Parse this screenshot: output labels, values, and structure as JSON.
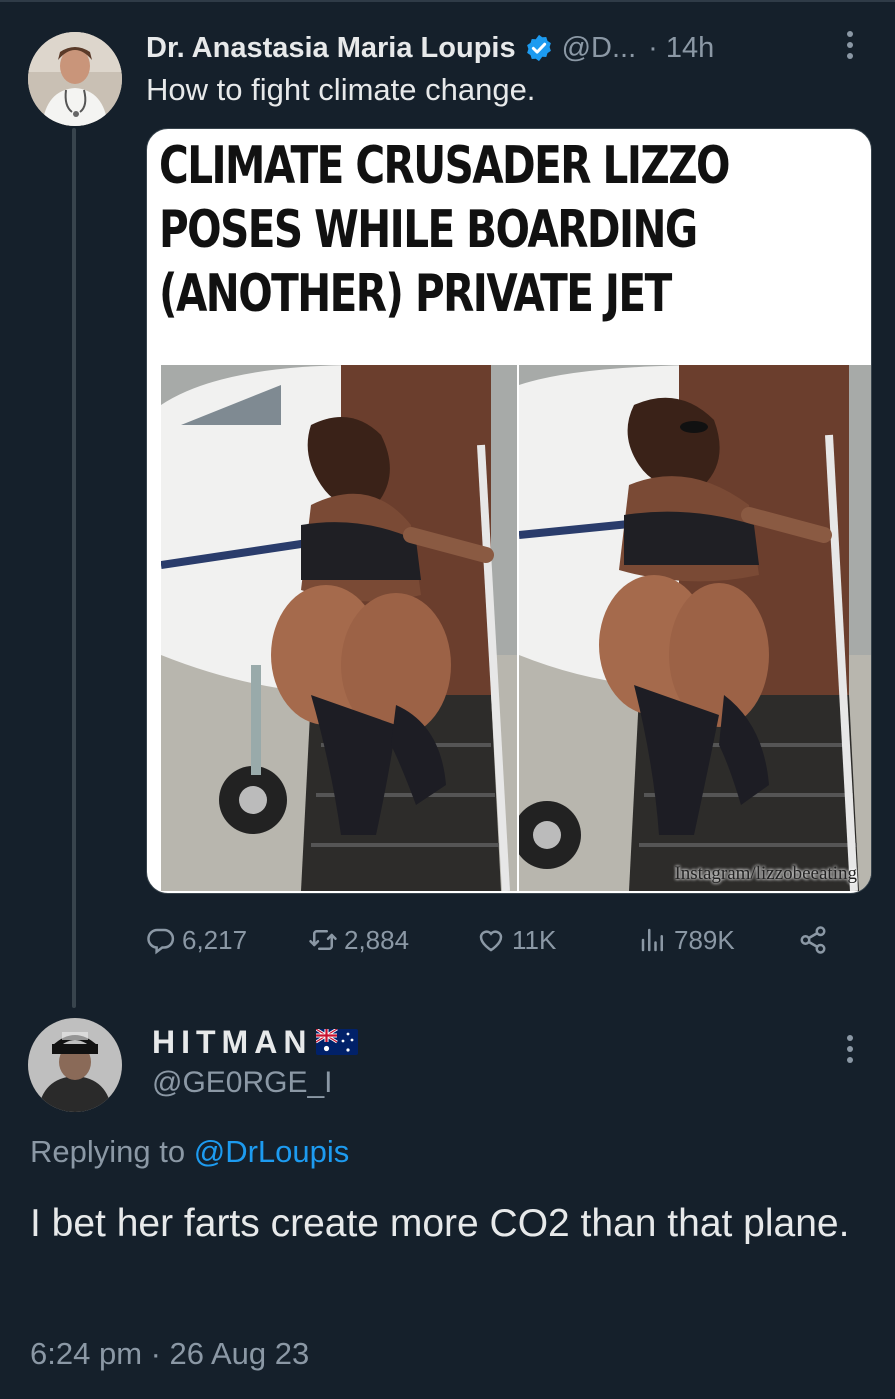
{
  "tweet": {
    "author_name": "Dr. Anastasia Maria Loupis",
    "verified_icon": "verified-badge-icon",
    "handle": "@D...",
    "separator": "·",
    "time": "14h",
    "text": "How to fight climate change.",
    "media": {
      "headline_lines": [
        "CLIMATE CRUSADER LIZZO",
        "POSES WHILE BOARDING",
        "(ANOTHER) PRIVATE JET"
      ],
      "credit": "Instagram/lizzobeeating"
    },
    "actions": {
      "replies": "6,217",
      "retweets": "2,884",
      "likes": "11K",
      "views": "789K"
    }
  },
  "reply": {
    "author_name": "HITMAN",
    "flag_icon": "australia-flag-icon",
    "handle": "@GE0RGE_I",
    "replying_prefix": "Replying to",
    "replying_to": "@DrLoupis",
    "text": "I bet her farts create more CO2 than that plane.",
    "timestamp": "6:24 pm · 26 Aug 23"
  },
  "colors": {
    "background": "#15202b",
    "primary_text": "#e7e9ea",
    "secondary_text": "#8b98a5",
    "accent": "#1d9bf0"
  }
}
